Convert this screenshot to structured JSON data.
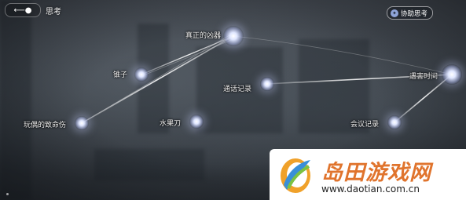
{
  "header": {
    "title": "思考",
    "menu_icon": "back-arrow-icon"
  },
  "assist_button": {
    "label": "协助思考",
    "icon": "brain-icon"
  },
  "nodes": [
    {
      "id": "true-weapon",
      "label": "真正的凶器"
    },
    {
      "id": "awl",
      "label": "锥子"
    },
    {
      "id": "call-log",
      "label": "通话记录"
    },
    {
      "id": "attack-time",
      "label": "遇害时间"
    },
    {
      "id": "doll-wound",
      "label": "玩偶的致命伤"
    },
    {
      "id": "fruit-knife",
      "label": "水果刀"
    },
    {
      "id": "meeting-log",
      "label": "会议记录"
    }
  ],
  "watermark": {
    "title": "岛田游戏网",
    "url": "www.daotian.com.cn"
  },
  "colors": {
    "accent": "#e0742d",
    "node_glow": "#dfe6ff"
  }
}
